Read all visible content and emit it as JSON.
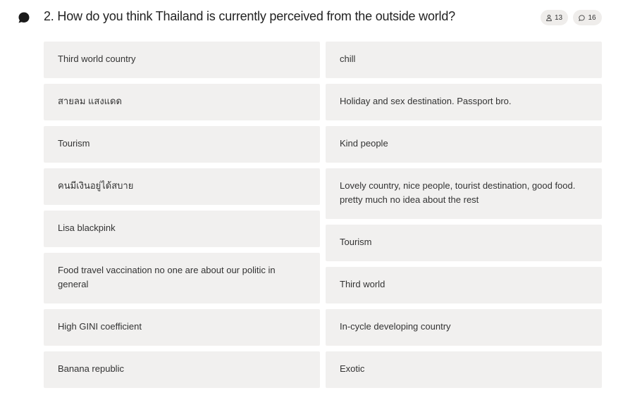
{
  "question": {
    "title": "2. How do you think Thailand is currently perceived from the outside world?",
    "participants_count": "13",
    "responses_count": "16"
  },
  "responses": {
    "left": [
      "Third world country",
      "สายลม แสงแดด",
      "Tourism",
      "คนมีเงินอยู่ได้สบาย",
      "Lisa blackpink",
      "Food travel vaccination no one are about our politic in general",
      "High GINI coefficient",
      "Banana republic"
    ],
    "right": [
      "chill",
      "Holiday and sex destination. Passport bro.",
      "Kind people",
      "Lovely country, nice people, tourist destination, good food. pretty much no idea about the rest",
      "Tourism",
      "Third world",
      "In-cycle developing country",
      "Exotic"
    ]
  },
  "icons": {
    "question": "speech-bubble-icon",
    "participants": "person-icon",
    "responses": "comment-icon"
  }
}
